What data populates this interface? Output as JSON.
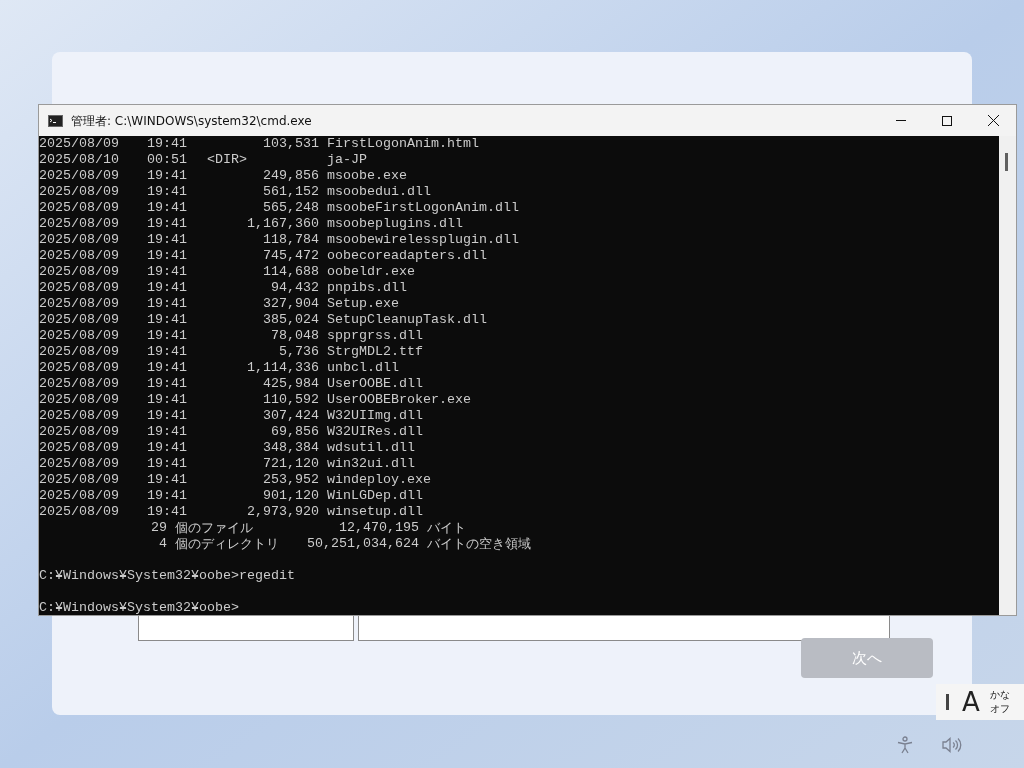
{
  "setup_screen": {
    "next_button": {
      "label": "次へ",
      "disabled": true
    }
  },
  "cmd_window": {
    "title": "管理者: C:\\WINDOWS\\system32\\cmd.exe",
    "listing": [
      {
        "kind": "file",
        "date": "2025/08/09",
        "time": "19:41",
        "size": "103,531",
        "name": "FirstLogonAnim.html"
      },
      {
        "kind": "dir",
        "date": "2025/08/10",
        "time": "00:51",
        "size": "<DIR>",
        "name": "ja-JP"
      },
      {
        "kind": "file",
        "date": "2025/08/09",
        "time": "19:41",
        "size": "249,856",
        "name": "msoobe.exe"
      },
      {
        "kind": "file",
        "date": "2025/08/09",
        "time": "19:41",
        "size": "561,152",
        "name": "msoobedui.dll"
      },
      {
        "kind": "file",
        "date": "2025/08/09",
        "time": "19:41",
        "size": "565,248",
        "name": "msoobeFirstLogonAnim.dll"
      },
      {
        "kind": "file",
        "date": "2025/08/09",
        "time": "19:41",
        "size": "1,167,360",
        "name": "msoobeplugins.dll"
      },
      {
        "kind": "file",
        "date": "2025/08/09",
        "time": "19:41",
        "size": "118,784",
        "name": "msoobewirelessplugin.dll"
      },
      {
        "kind": "file",
        "date": "2025/08/09",
        "time": "19:41",
        "size": "745,472",
        "name": "oobecoreadapters.dll"
      },
      {
        "kind": "file",
        "date": "2025/08/09",
        "time": "19:41",
        "size": "114,688",
        "name": "oobeldr.exe"
      },
      {
        "kind": "file",
        "date": "2025/08/09",
        "time": "19:41",
        "size": "94,432",
        "name": "pnpibs.dll"
      },
      {
        "kind": "file",
        "date": "2025/08/09",
        "time": "19:41",
        "size": "327,904",
        "name": "Setup.exe"
      },
      {
        "kind": "file",
        "date": "2025/08/09",
        "time": "19:41",
        "size": "385,024",
        "name": "SetupCleanupTask.dll"
      },
      {
        "kind": "file",
        "date": "2025/08/09",
        "time": "19:41",
        "size": "78,048",
        "name": "spprgrss.dll"
      },
      {
        "kind": "file",
        "date": "2025/08/09",
        "time": "19:41",
        "size": "5,736",
        "name": "StrgMDL2.ttf"
      },
      {
        "kind": "file",
        "date": "2025/08/09",
        "time": "19:41",
        "size": "1,114,336",
        "name": "unbcl.dll"
      },
      {
        "kind": "file",
        "date": "2025/08/09",
        "time": "19:41",
        "size": "425,984",
        "name": "UserOOBE.dll"
      },
      {
        "kind": "file",
        "date": "2025/08/09",
        "time": "19:41",
        "size": "110,592",
        "name": "UserOOBEBroker.exe"
      },
      {
        "kind": "file",
        "date": "2025/08/09",
        "time": "19:41",
        "size": "307,424",
        "name": "W32UIImg.dll"
      },
      {
        "kind": "file",
        "date": "2025/08/09",
        "time": "19:41",
        "size": "69,856",
        "name": "W32UIRes.dll"
      },
      {
        "kind": "file",
        "date": "2025/08/09",
        "time": "19:41",
        "size": "348,384",
        "name": "wdsutil.dll"
      },
      {
        "kind": "file",
        "date": "2025/08/09",
        "time": "19:41",
        "size": "721,120",
        "name": "win32ui.dll"
      },
      {
        "kind": "file",
        "date": "2025/08/09",
        "time": "19:41",
        "size": "253,952",
        "name": "windeploy.exe"
      },
      {
        "kind": "file",
        "date": "2025/08/09",
        "time": "19:41",
        "size": "901,120",
        "name": "WinLGDep.dll"
      },
      {
        "kind": "file",
        "date": "2025/08/09",
        "time": "19:41",
        "size": "2,973,920",
        "name": "winsetup.dll"
      }
    ],
    "summary": [
      {
        "count": "29",
        "label": "個のファイル",
        "value": "12,470,195",
        "unit": "バイト"
      },
      {
        "count": "4",
        "label": "個のディレクトリ",
        "value": "50,251,034,624",
        "unit": "バイトの空き領域"
      }
    ],
    "prompts": [
      "C:¥Windows¥System32¥oobe>regedit",
      "C:¥Windows¥System32¥oobe>"
    ]
  },
  "ime": {
    "mode": "A",
    "kana": "かな",
    "state": "オフ"
  }
}
